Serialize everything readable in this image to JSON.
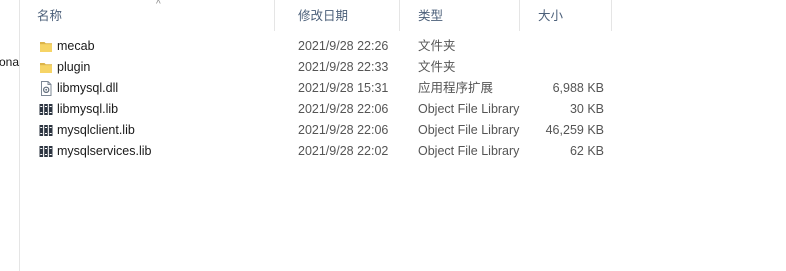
{
  "sidebar": {
    "cut_label": "ona"
  },
  "columns": {
    "name": "名称",
    "date": "修改日期",
    "type": "类型",
    "size": "大小"
  },
  "files": [
    {
      "name": "mecab",
      "date": "2021/9/28 22:26",
      "type": "文件夹",
      "size": "",
      "icon": "folder-icon"
    },
    {
      "name": "plugin",
      "date": "2021/9/28 22:33",
      "type": "文件夹",
      "size": "",
      "icon": "folder-icon"
    },
    {
      "name": "libmysql.dll",
      "date": "2021/9/28 15:31",
      "type": "应用程序扩展",
      "size": "6,988 KB",
      "icon": "dll-file-icon"
    },
    {
      "name": "libmysql.lib",
      "date": "2021/9/28 22:06",
      "type": "Object File Library",
      "size": "30 KB",
      "icon": "lib-file-icon"
    },
    {
      "name": "mysqlclient.lib",
      "date": "2021/9/28 22:06",
      "type": "Object File Library",
      "size": "46,259 KB",
      "icon": "lib-file-icon"
    },
    {
      "name": "mysqlservices.lib",
      "date": "2021/9/28 22:02",
      "type": "Object File Library",
      "size": "62 KB",
      "icon": "lib-file-icon"
    }
  ]
}
